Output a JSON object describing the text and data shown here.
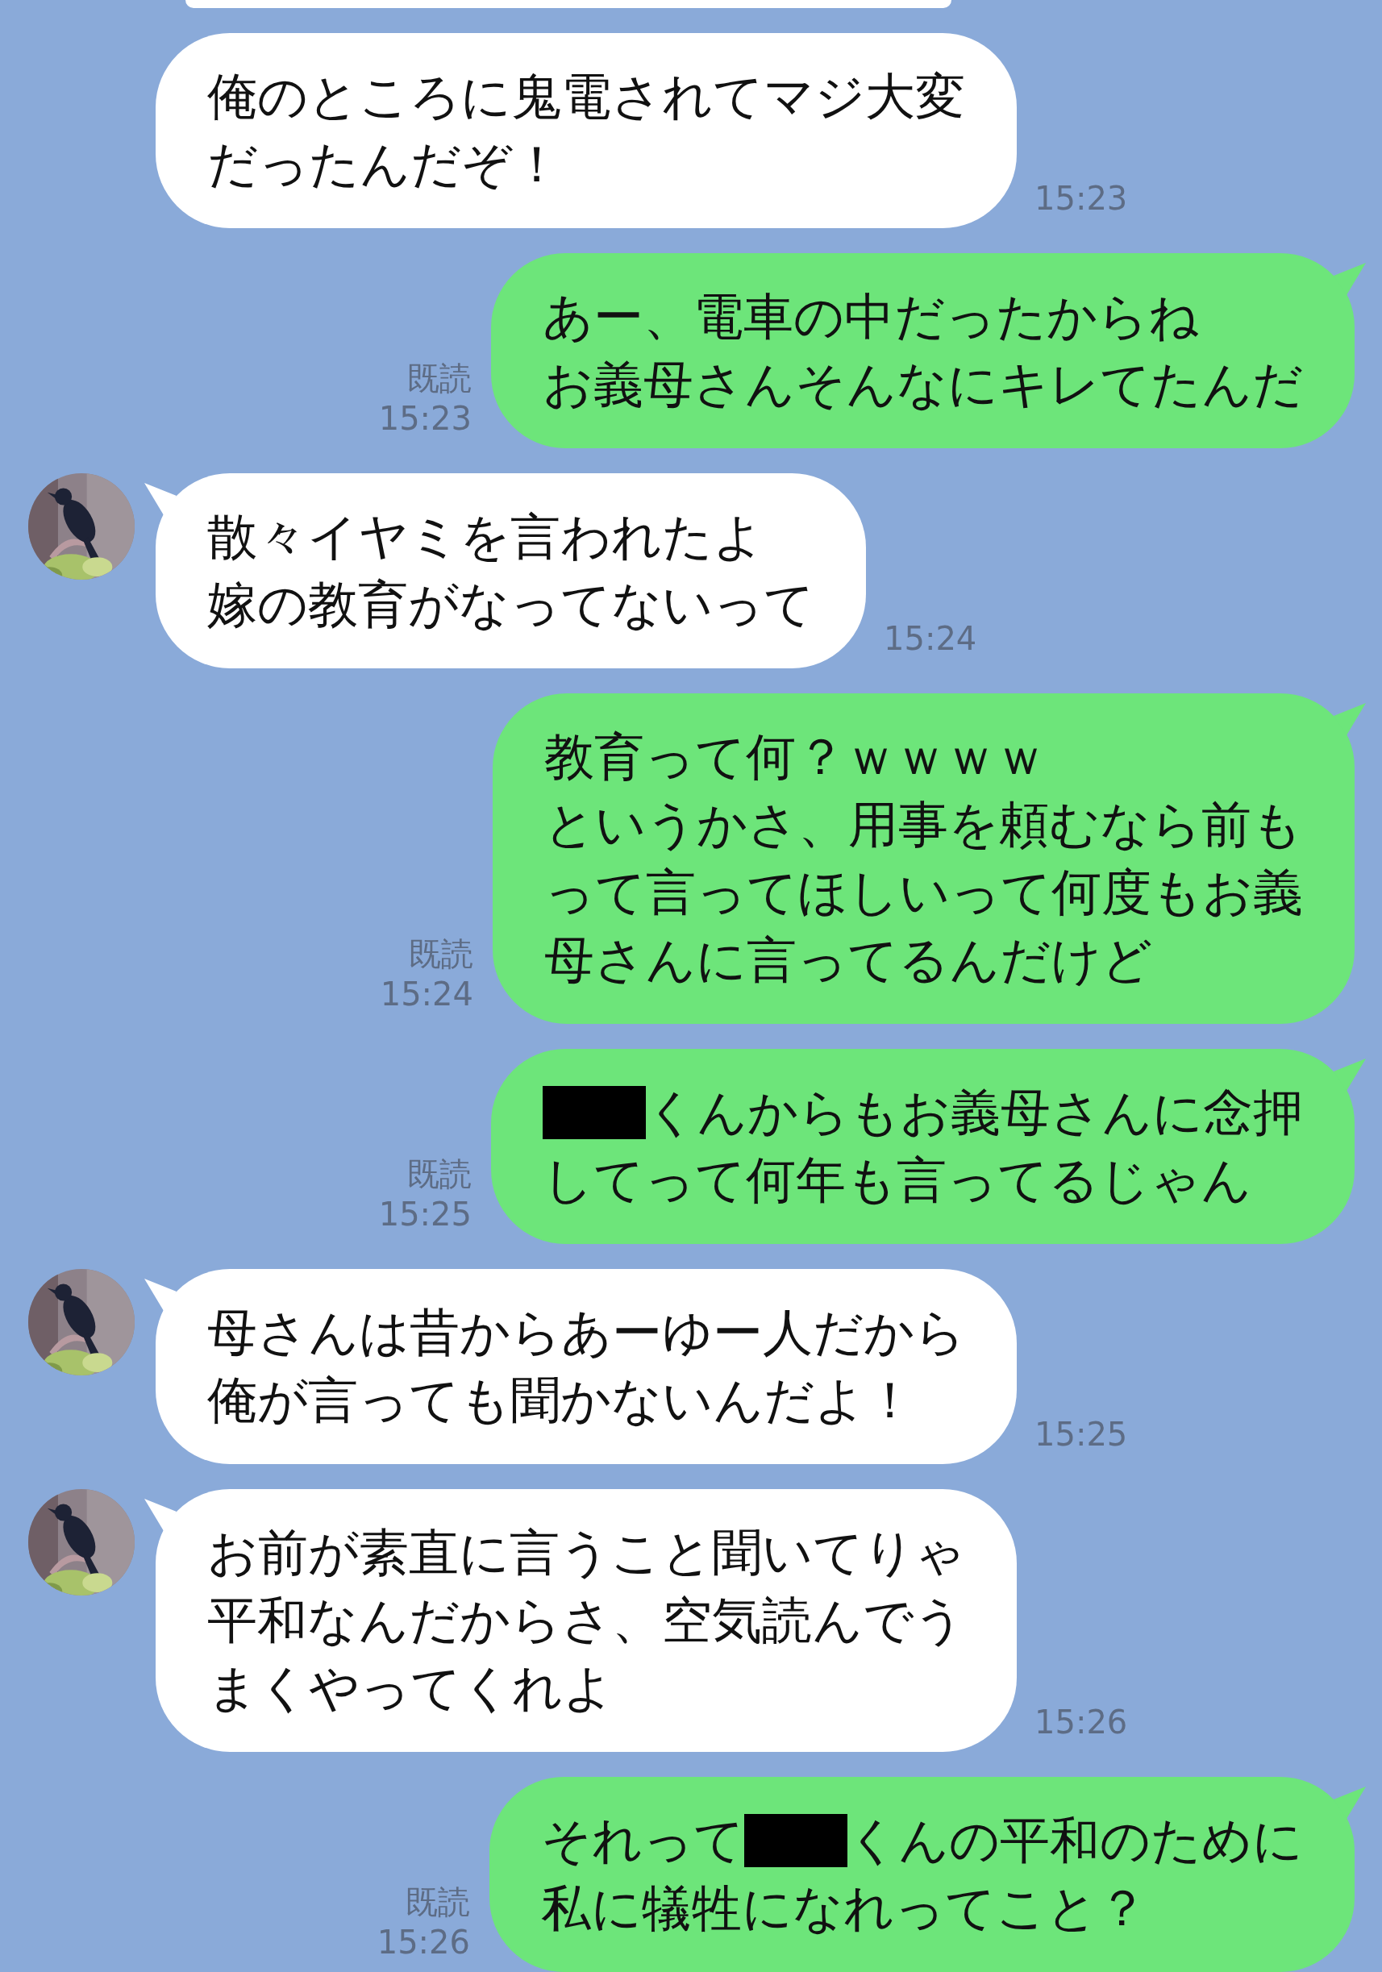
{
  "messages": [
    {
      "kind": "clipped"
    },
    {
      "kind": "incoming",
      "avatar": false,
      "lines": [
        [
          {
            "kind": "text",
            "text": "俺のところに鬼電されてマジ大変"
          }
        ],
        [
          {
            "kind": "text",
            "text": "だったんだぞ！"
          }
        ]
      ],
      "time": "15:23"
    },
    {
      "kind": "outgoing",
      "read": "既読",
      "lines": [
        [
          {
            "kind": "text",
            "text": "あー、電車の中だったからね"
          }
        ],
        [
          {
            "kind": "text",
            "text": "お義母さんそんなにキレてたんだ"
          }
        ]
      ],
      "time": "15:23"
    },
    {
      "kind": "incoming",
      "avatar": true,
      "lines": [
        [
          {
            "kind": "text",
            "text": "散々イヤミを言われたよ"
          }
        ],
        [
          {
            "kind": "text",
            "text": "嫁の教育がなってないって"
          }
        ]
      ],
      "time": "15:24"
    },
    {
      "kind": "outgoing",
      "read": "既読",
      "lines": [
        [
          {
            "kind": "text",
            "text": "教育って何？ｗｗｗｗ"
          }
        ],
        [
          {
            "kind": "text",
            "text": "というかさ、用事を頼むなら前も"
          }
        ],
        [
          {
            "kind": "text",
            "text": "って言ってほしいって何度もお義"
          }
        ],
        [
          {
            "kind": "text",
            "text": "母さんに言ってるんだけど"
          }
        ]
      ],
      "time": "15:24"
    },
    {
      "kind": "outgoing",
      "read": "既読",
      "lines": [
        [
          {
            "kind": "redaction"
          },
          {
            "kind": "text",
            "text": "くんからもお義母さんに念押"
          }
        ],
        [
          {
            "kind": "text",
            "text": "してって何年も言ってるじゃん"
          }
        ]
      ],
      "time": "15:25"
    },
    {
      "kind": "incoming",
      "avatar": true,
      "lines": [
        [
          {
            "kind": "text",
            "text": "母さんは昔からあーゆー人だから"
          }
        ],
        [
          {
            "kind": "text",
            "text": "俺が言っても聞かないんだよ！"
          }
        ]
      ],
      "time": "15:25"
    },
    {
      "kind": "incoming",
      "avatar": true,
      "lines": [
        [
          {
            "kind": "text",
            "text": "お前が素直に言うこと聞いてりゃ"
          }
        ],
        [
          {
            "kind": "text",
            "text": "平和なんだからさ、空気読んでう"
          }
        ],
        [
          {
            "kind": "text",
            "text": "まくやってくれよ"
          }
        ]
      ],
      "time": "15:26"
    },
    {
      "kind": "outgoing",
      "read": "既読",
      "lines": [
        [
          {
            "kind": "text",
            "text": "それって"
          },
          {
            "kind": "redaction"
          },
          {
            "kind": "text",
            "text": "くんの平和のために"
          }
        ],
        [
          {
            "kind": "text",
            "text": "私に犠牲になれってこと？"
          }
        ]
      ],
      "time": "15:26"
    }
  ]
}
